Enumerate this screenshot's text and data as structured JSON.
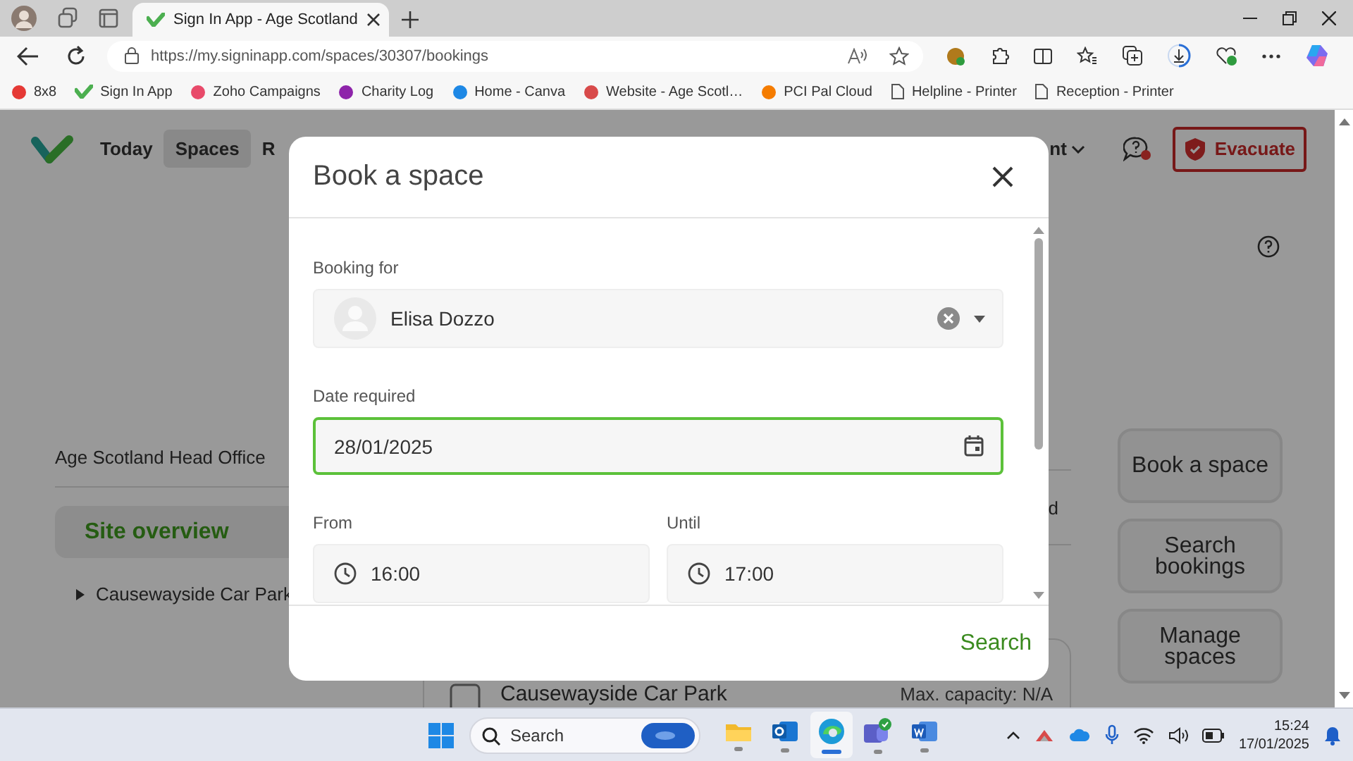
{
  "browser": {
    "tabs": [
      {
        "title": "Sign In App - Age Scotland",
        "selected": true
      }
    ],
    "url": "https://my.signinapp.com/spaces/30307/bookings",
    "bookmarks": [
      {
        "label": "8x8",
        "kind": "logo",
        "color": "#e53935"
      },
      {
        "label": "Sign In App",
        "kind": "check",
        "color": "#4caf50"
      },
      {
        "label": "Zoho Campaigns",
        "kind": "logo",
        "color": "#e84a6a"
      },
      {
        "label": "Charity Log",
        "kind": "logo",
        "color": "#8e24aa"
      },
      {
        "label": "Home - Canva",
        "kind": "logo",
        "color": "#1e88e5"
      },
      {
        "label": "Website - Age Scotl…",
        "kind": "logo",
        "color": "#d84a4a"
      },
      {
        "label": "PCI Pal Cloud",
        "kind": "logo",
        "color": "#f57c00"
      },
      {
        "label": "Helpline - Printer",
        "kind": "page",
        "color": "#555555"
      },
      {
        "label": "Reception - Printer",
        "kind": "page",
        "color": "#555555"
      }
    ]
  },
  "app": {
    "nav": [
      {
        "label": "Today",
        "selected": false
      },
      {
        "label": "Spaces",
        "selected": true
      },
      {
        "label": "R",
        "selected": false
      }
    ],
    "nav_menu": "nt",
    "evacuate_button": "Evacuate",
    "site_name": "Age Scotland Head Office",
    "sidebar": [
      {
        "label": "Site overview",
        "selected": true
      }
    ],
    "tree": [
      {
        "label": "Causewayside Car Park",
        "expanded": false
      }
    ],
    "column_text": "d",
    "card": {
      "title": "Causewayside Car Park",
      "capacity": "Max. capacity: N/A"
    },
    "actions": [
      "Book a space",
      "Search bookings",
      "Manage spaces"
    ]
  },
  "dialog": {
    "title": "Book a space",
    "fields": [
      {
        "kind": "person",
        "label": "Booking for",
        "value": "Elisa Dozzo",
        "focused": false
      },
      {
        "kind": "date",
        "label": "Date required",
        "value": "28/01/2025",
        "focused": true
      }
    ],
    "time_fields": [
      {
        "label": "From",
        "value": "16:00"
      },
      {
        "label": "Until",
        "value": "17:00"
      }
    ],
    "search_button": "Search"
  },
  "taskbar": {
    "search": {
      "placeholder": "Search"
    },
    "apps": [
      {
        "kind": "folder",
        "selected": false
      },
      {
        "kind": "outlook",
        "selected": false
      },
      {
        "kind": "edge",
        "selected": true
      },
      {
        "kind": "teams",
        "selected": false
      },
      {
        "kind": "word",
        "selected": false
      }
    ],
    "time": "15:24",
    "date": "17/01/2025"
  }
}
